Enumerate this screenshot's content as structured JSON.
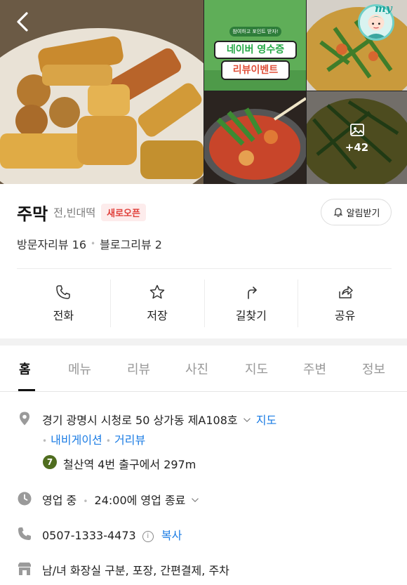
{
  "gallery": {
    "more_count": "+42",
    "my_label": "my",
    "event_banner": {
      "top_text": "참여하고 포인트 받자!",
      "line1": "네이버 영수증",
      "line2": "리뷰이벤트"
    }
  },
  "place": {
    "name": "주막",
    "category": "전,빈대떡",
    "badge": "새로오픈",
    "alarm_label": "알림받기",
    "visitor_review": "방문자리뷰 16",
    "blog_review": "블로그리뷰 2"
  },
  "actions": [
    {
      "label": "전화",
      "icon": "phone-icon"
    },
    {
      "label": "저장",
      "icon": "star-icon"
    },
    {
      "label": "길찾기",
      "icon": "directions-icon"
    },
    {
      "label": "공유",
      "icon": "share-icon"
    }
  ],
  "tabs": [
    "홈",
    "메뉴",
    "리뷰",
    "사진",
    "지도",
    "주변",
    "정보"
  ],
  "active_tab": "홈",
  "info": {
    "address": "경기 광명시 시청로 50 상가동 제A108호",
    "map_link": "지도",
    "navigation_link": "내비게이션",
    "streetview_link": "거리뷰",
    "subway_line": "7",
    "subway_text": "철산역 4번 출구에서 297m",
    "hours_status": "영업 중",
    "hours_text": "24:00에 영업 종료",
    "phone": "0507-1333-4473",
    "copy_label": "복사",
    "facilities": "남/녀 화장실 구분, 포장, 간편결제, 주차"
  },
  "colors": {
    "link": "#1b7ce4",
    "badge_text": "#e0413c",
    "badge_bg": "#fdecec",
    "subway_line7": "#4f6d1f"
  }
}
